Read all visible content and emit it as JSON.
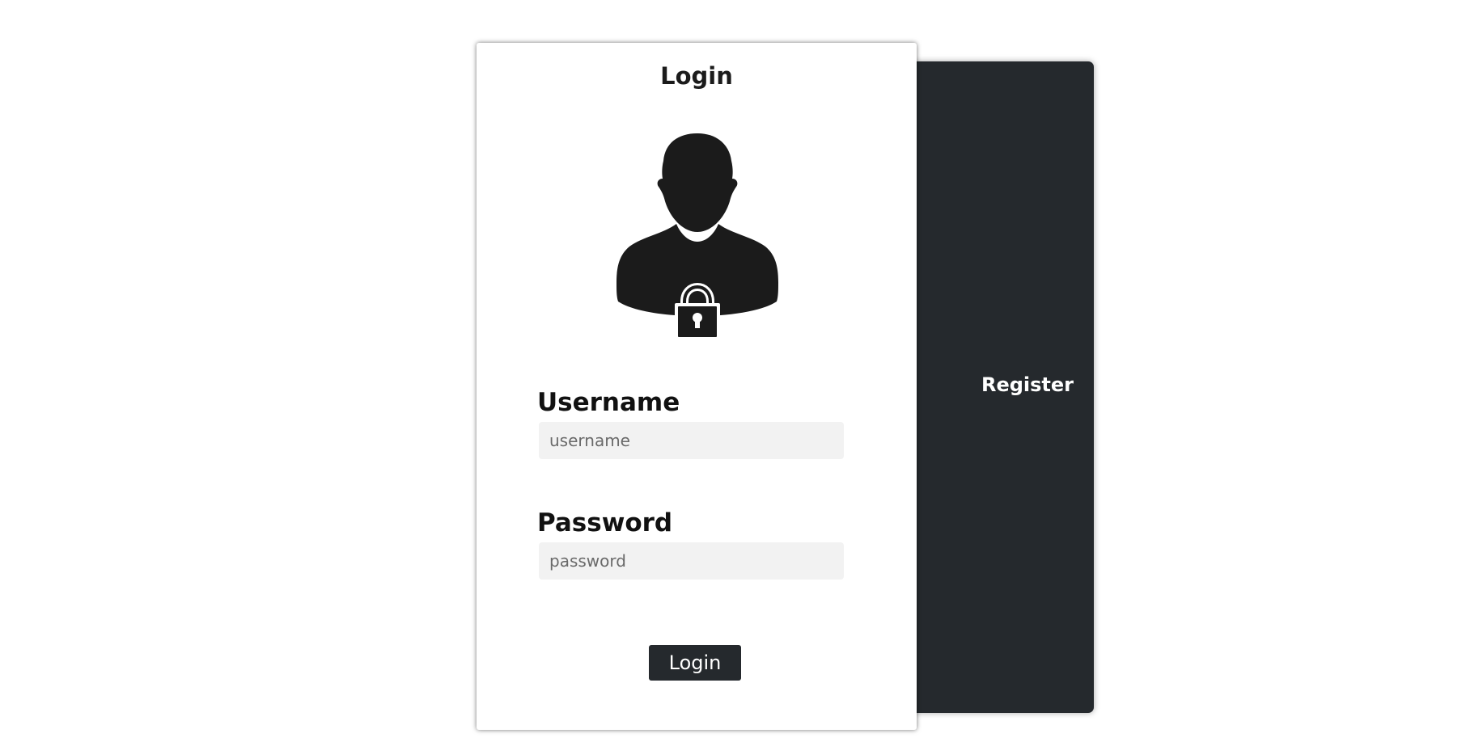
{
  "register_panel": {
    "label": "Register",
    "background_color": "#25292d"
  },
  "login_card": {
    "title": "Login",
    "avatar_icon": "user-lock-icon",
    "username": {
      "label": "Username",
      "placeholder": "username",
      "value": ""
    },
    "password": {
      "label": "Password",
      "placeholder": "password",
      "value": ""
    },
    "submit_label": "Login",
    "button_color": "#25292d"
  }
}
